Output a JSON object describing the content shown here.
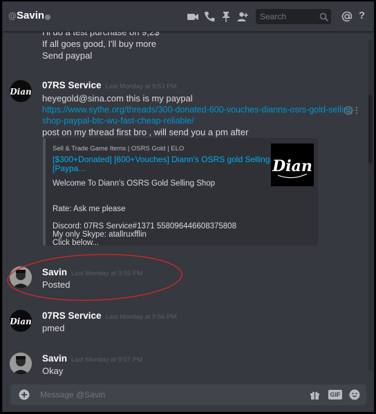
{
  "header": {
    "at_symbol": "@",
    "channel_name": "Savin",
    "search_placeholder": "Search",
    "help_label": "?"
  },
  "messages": {
    "group0": {
      "lines": [
        "I'll do a test purchase on 9,2$",
        "If all goes good, I'll buy more",
        "Send paypal"
      ]
    },
    "group1": {
      "author": "07RS Service",
      "timestamp": "Last Monday at 9:53 PM",
      "line1": "heyegold@sina.com this is my paypal",
      "link_line1": "https://www.sythe.org/threads/300-donated-600-vouches-dianns-osrs-gold-selling-",
      "link_line2": "shop-paypal-btc-wu-fast-cheap-reliable/",
      "line4": "post on my thread first bro , will send you a pm after",
      "embed": {
        "provider": "Sell & Trade Game Items | OSRS Gold | ELO",
        "title_line1": "[$300+Donated] [600+Vouches] Diann's OSRS gold Selling shop",
        "title_line2": "[Paypa...",
        "desc_line1": "Welcome To Diann's OSRS Gold Selling Shop",
        "desc_line2": "Rate: Ask me please",
        "desc_line3": "Discord: 07RS Service#1371 558096446608375808",
        "desc_line4": "My only Skype: atallruxfflin",
        "desc_line5": "Click below...",
        "thumb_text": "Dian"
      }
    },
    "group2": {
      "author": "Savin",
      "timestamp": "Last Monday at 9:55 PM",
      "text": "Posted"
    },
    "group3": {
      "author": "07RS Service",
      "timestamp": "Last Monday at 9:56 PM",
      "text": "pmed"
    },
    "group4": {
      "author": "Savin",
      "timestamp": "Last Monday at 9:57 PM",
      "text": "Okay"
    }
  },
  "avatar_text": "Dian",
  "composer": {
    "placeholder": "Message @Savin",
    "gif_label": "GIF"
  },
  "colors": {
    "background": "#36393f",
    "header_text": "#ffffff",
    "link": "#0096cf",
    "annotation": "#cc2b2b"
  },
  "icons": [
    "at-icon",
    "video-call-icon",
    "phone-call-icon",
    "pin-icon",
    "add-friend-icon",
    "search-icon",
    "mention-icon",
    "help-icon",
    "add-reaction-icon",
    "more-options-icon",
    "upload-icon",
    "gift-icon",
    "gif-icon",
    "emoji-icon"
  ]
}
